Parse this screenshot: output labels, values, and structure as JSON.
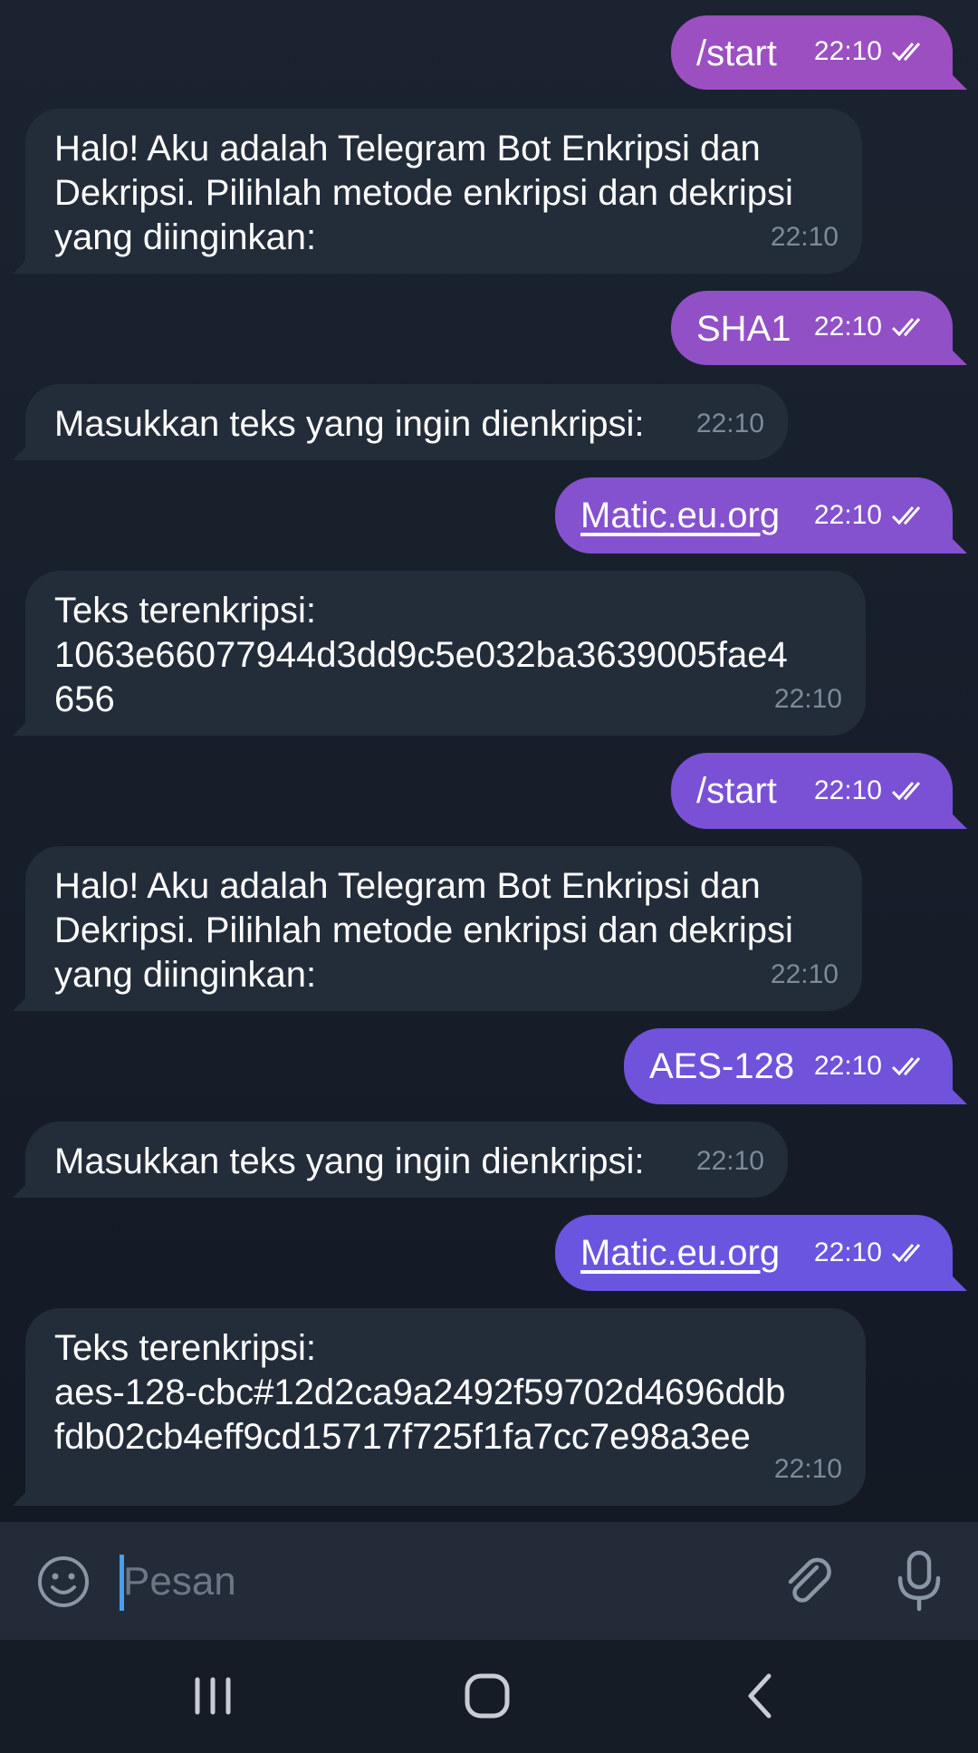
{
  "messages": [
    {
      "dir": "out",
      "text": "/start",
      "time": "22:10",
      "color": "#9b4fc0"
    },
    {
      "dir": "in",
      "text": "Halo! Aku adalah Telegram Bot Enkripsi dan\nDekripsi. Pilihlah metode enkripsi dan dekripsi\nyang diinginkan:",
      "time": "22:10"
    },
    {
      "dir": "out",
      "text": "SHA1",
      "time": "22:10",
      "color": "#9150c6"
    },
    {
      "dir": "in",
      "text": "Masukkan teks yang ingin dienkripsi:",
      "time": "22:10"
    },
    {
      "dir": "out",
      "text": "Matic.eu.org",
      "time": "22:10",
      "link": true,
      "color": "#8451cf"
    },
    {
      "dir": "in",
      "text": "Teks terenkripsi:\n1063e66077944d3dd9c5e032ba3639005fae4\n656",
      "time": "22:10"
    },
    {
      "dir": "out",
      "text": "/start",
      "time": "22:10",
      "color": "#7a51d5"
    },
    {
      "dir": "in",
      "text": "Halo! Aku adalah Telegram Bot Enkripsi dan\nDekripsi. Pilihlah metode enkripsi dan dekripsi\nyang diinginkan:",
      "time": "22:10"
    },
    {
      "dir": "out",
      "text": "AES-128",
      "time": "22:10",
      "color": "#7052db"
    },
    {
      "dir": "in",
      "text": "Masukkan teks yang ingin dienkripsi:",
      "time": "22:10"
    },
    {
      "dir": "out",
      "text": "Matic.eu.org",
      "time": "22:10",
      "link": true,
      "color": "#6955df"
    },
    {
      "dir": "in",
      "text": "Teks terenkripsi:\naes-128-cbc#12d2ca9a2492f59702d4696ddb\nfdb02cb4eff9cd15717f725f1fa7cc7e98a3ee",
      "time": "22:10"
    }
  ],
  "composer": {
    "placeholder": "Pesan"
  },
  "icons": {
    "emoji": "emoji-icon",
    "attach": "paperclip-icon",
    "mic": "microphone-icon",
    "read": "double-check-icon"
  },
  "navbar": {
    "recent": "recent-apps-icon",
    "home": "home-icon",
    "back": "back-icon"
  }
}
